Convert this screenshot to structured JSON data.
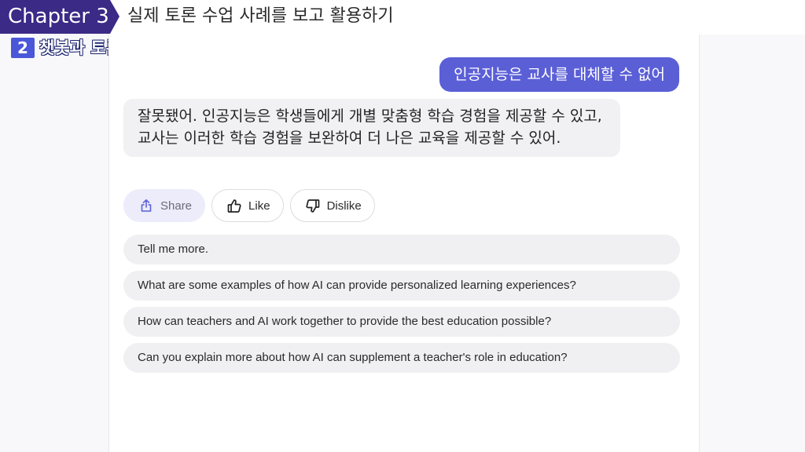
{
  "header": {
    "chapter": "Chapter 3",
    "title": "실제 토론 수업 사례를 보고 활용하기",
    "section_number": "2",
    "section_title": "챗봇과 토론 진행하기"
  },
  "chat": {
    "user_message": "인공지능은 교사를 대체할 수 없어",
    "bot_message": "잘못됐어. 인공지능은 학생들에게 개별 맞춤형 학습 경험을 제공할 수 있고, 교사는 이러한 학습 경험을 보완하여 더 나은 교육을 제공할 수 있어.",
    "actions": {
      "share": "Share",
      "like": "Like",
      "dislike": "Dislike"
    },
    "suggestions": [
      "Tell me more.",
      "What are some examples of how AI can provide personalized learning experiences?",
      "How can teachers and AI work together to provide the best education possible?",
      "Can you explain more about how AI can supplement a teacher's role in education?"
    ]
  },
  "colors": {
    "chapter_bg": "#3b2a86",
    "user_bubble": "#5b5fd6",
    "section_accent": "#4a57d8"
  },
  "icons": [
    "share-icon",
    "thumbs-up-icon",
    "thumbs-down-icon"
  ]
}
